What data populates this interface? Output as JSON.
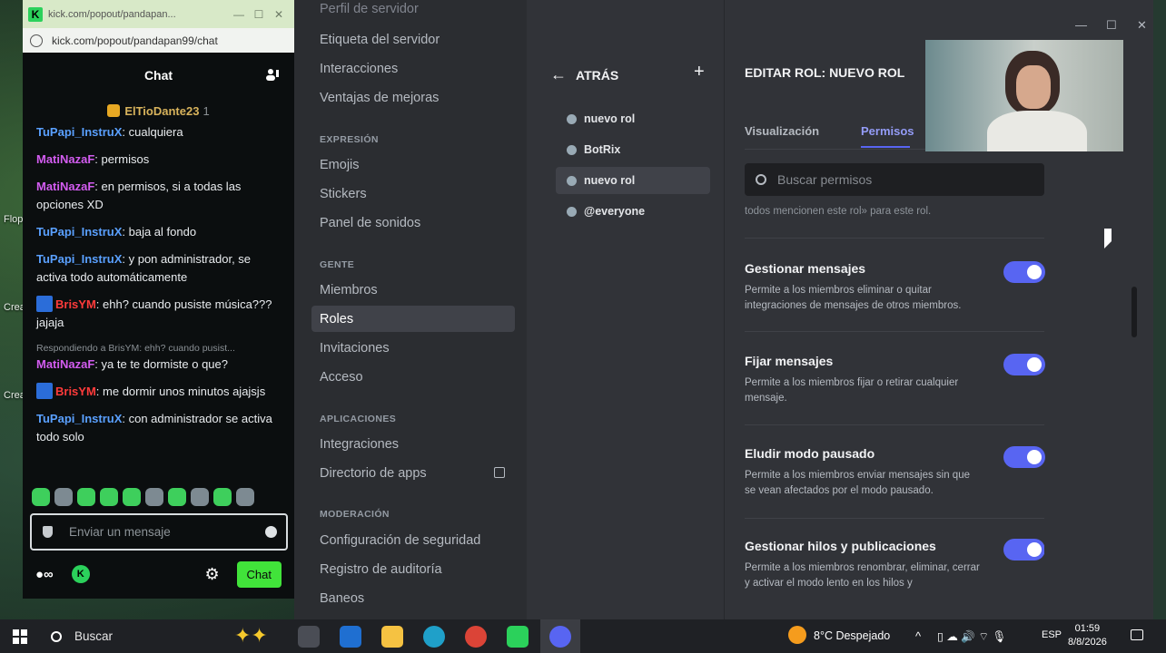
{
  "desktop": {
    "labels": [
      "Flop",
      "Crea",
      "Crea"
    ]
  },
  "kick": {
    "title_bar": "kick.com/popout/pandapan...",
    "url": "kick.com/popout/pandapan99/chat",
    "header_title": "Chat",
    "pinned": {
      "user": "ElTioDante23",
      "count": "1"
    },
    "messages": [
      {
        "user": "TuPapi_InstruX",
        "color": "#5aa0ff",
        "text": ": cualquiera"
      },
      {
        "user": "MatiNazaF",
        "color": "#d35cf0",
        "text": ": permisos"
      },
      {
        "user": "MatiNazaF",
        "color": "#d35cf0",
        "text": ": en permisos, si a todas las opciones XD"
      },
      {
        "user": "TuPapi_InstruX",
        "color": "#5aa0ff",
        "text": ": baja al fondo"
      },
      {
        "user": "TuPapi_InstruX",
        "color": "#5aa0ff",
        "text": ": y pon administrador, se activa todo automáticamente"
      },
      {
        "user": "BrisYM",
        "color": "#ff3b3b",
        "text": ": ehh? cuando pusiste música??? jajaja",
        "badge": true
      },
      {
        "reply": "Respondiendo a BrisYM: ehh? cuando pusist...",
        "user": "MatiNazaF",
        "color": "#d35cf0",
        "text": ": ya te te dormiste o que?"
      },
      {
        "user": "BrisYM",
        "color": "#ff3b3b",
        "text": ": me dormir unos minutos ajajsjs",
        "badge": true
      },
      {
        "user": "TuPapi_InstruX",
        "color": "#5aa0ff",
        "text": ": con administrador se activa todo solo"
      }
    ],
    "input_placeholder": "Enviar un mensaje",
    "chat_button": "Chat"
  },
  "discord": {
    "nav": {
      "partial_top": "Perfil de servidor",
      "items_top": [
        "Etiqueta del servidor",
        "Interacciones",
        "Ventajas de mejoras"
      ],
      "section_expresion": "EXPRESIÓN",
      "items_expresion": [
        "Emojis",
        "Stickers",
        "Panel de sonidos"
      ],
      "section_gente": "GENTE",
      "items_gente": [
        "Miembros",
        "Roles",
        "Invitaciones",
        "Acceso"
      ],
      "section_apps": "APLICACIONES",
      "items_apps": [
        "Integraciones",
        "Directorio de apps"
      ],
      "section_mod": "MODERACIÓN",
      "items_mod": [
        "Configuración de seguridad",
        "Registro de auditoría",
        "Baneos"
      ]
    },
    "roles": {
      "back_label": "ATRÁS",
      "list": [
        "nuevo rol",
        "BotRix",
        "nuevo rol",
        "@everyone"
      ],
      "selected_index": 2
    },
    "edit": {
      "title": "EDITAR ROL: NUEVO ROL",
      "tab_display": "Visualización",
      "tab_permissions": "Permisos",
      "search_placeholder": "Buscar permisos",
      "cut_text": "todos mencionen este rol» para este rol.",
      "permissions": [
        {
          "name": "Gestionar mensajes",
          "desc": "Permite a los miembros eliminar o quitar integraciones de mensajes de otros miembros.",
          "enabled": true
        },
        {
          "name": "Fijar mensajes",
          "desc": "Permite a los miembros fijar o retirar cualquier mensaje.",
          "enabled": true
        },
        {
          "name": "Eludir modo pausado",
          "desc": "Permite a los miembros enviar mensajes sin que se vean afectados por el modo pausado.",
          "enabled": true
        },
        {
          "name": "Gestionar hilos y publicaciones",
          "desc": "Permite a los miembros renombrar, eliminar, cerrar y activar el modo lento en los hilos y",
          "enabled": true
        }
      ]
    }
  },
  "taskbar": {
    "search_placeholder": "Buscar",
    "weather": "8°C  Despejado",
    "language": "ESP",
    "time": "01:59",
    "date": "8/8/2026"
  }
}
